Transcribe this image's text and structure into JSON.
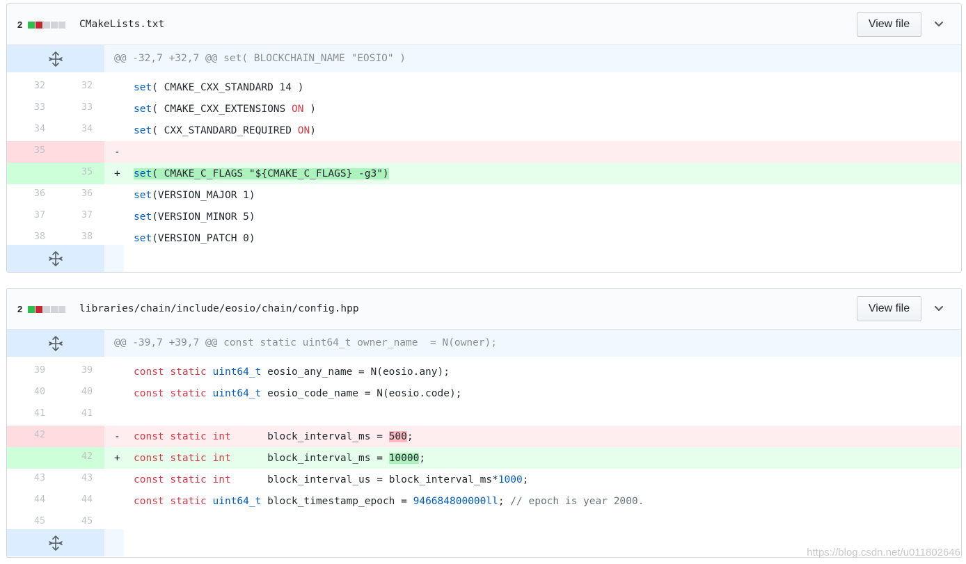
{
  "files": [
    {
      "diff_count": "2",
      "path": "CMakeLists.txt",
      "view_label": "View file",
      "hunk_header": "@@ -32,7 +32,7 @@ set( BLOCKCHAIN_NAME \"EOSIO\" )",
      "lines": [
        {
          "type": "ctx",
          "old": "32",
          "new": "32",
          "text": "set( CMAKE_CXX_STANDARD 14 )"
        },
        {
          "type": "ctx",
          "old": "33",
          "new": "33",
          "text": "set( CMAKE_CXX_EXTENSIONS ON )"
        },
        {
          "type": "ctx",
          "old": "34",
          "new": "34",
          "text": "set( CXX_STANDARD_REQUIRED ON)"
        },
        {
          "type": "del",
          "old": "35",
          "new": "",
          "sign": "-",
          "text": ""
        },
        {
          "type": "add",
          "old": "",
          "new": "35",
          "sign": "+",
          "text": "set( CMAKE_C_FLAGS \"${CMAKE_C_FLAGS} -g3\")"
        },
        {
          "type": "ctx",
          "old": "36",
          "new": "36",
          "text": "set(VERSION_MAJOR 1)"
        },
        {
          "type": "ctx",
          "old": "37",
          "new": "37",
          "text": "set(VERSION_MINOR 5)"
        },
        {
          "type": "ctx",
          "old": "38",
          "new": "38",
          "text": "set(VERSION_PATCH 0)"
        }
      ]
    },
    {
      "diff_count": "2",
      "path": "libraries/chain/include/eosio/chain/config.hpp",
      "view_label": "View file",
      "hunk_header": "@@ -39,7 +39,7 @@ const static uint64_t owner_name  = N(owner);",
      "lines": [
        {
          "type": "ctx",
          "old": "39",
          "new": "39",
          "text": "const static uint64_t eosio_any_name = N(eosio.any);"
        },
        {
          "type": "ctx",
          "old": "40",
          "new": "40",
          "text": "const static uint64_t eosio_code_name = N(eosio.code);"
        },
        {
          "type": "ctx",
          "old": "41",
          "new": "41",
          "text": ""
        },
        {
          "type": "del",
          "old": "42",
          "new": "",
          "sign": "-",
          "text": "const static int      block_interval_ms = 500;"
        },
        {
          "type": "add",
          "old": "",
          "new": "42",
          "sign": "+",
          "text": "const static int      block_interval_ms = 10000;"
        },
        {
          "type": "ctx",
          "old": "43",
          "new": "43",
          "text": "const static int      block_interval_us = block_interval_ms*1000;"
        },
        {
          "type": "ctx",
          "old": "44",
          "new": "44",
          "text": "const static uint64_t block_timestamp_epoch = 946684800000ll; // epoch is year 2000."
        },
        {
          "type": "ctx",
          "old": "45",
          "new": "45",
          "text": ""
        }
      ]
    }
  ],
  "watermark": "https://blog.csdn.net/u011802646",
  "colors": {
    "add_block": "#2cbe4e",
    "del_block": "#cb2431",
    "keyword": "#d73a49",
    "function": "#005cc5",
    "add_highlight": "#acf2bd",
    "del_highlight": "#fdb8c0"
  },
  "icons": [
    "unfold-icon",
    "chevron-down-icon"
  ]
}
